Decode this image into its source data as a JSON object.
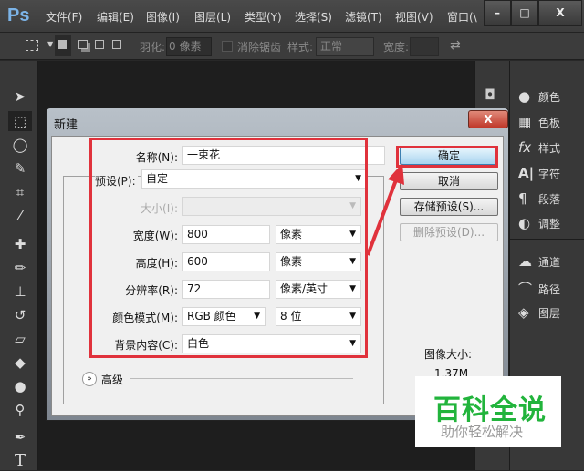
{
  "app": {
    "logo": "Ps",
    "menus": [
      "文件(F)",
      "编辑(E)",
      "图像(I)",
      "图层(L)",
      "类型(Y)",
      "选择(S)",
      "滤镜(T)",
      "视图(V)",
      "窗口(\\"
    ],
    "window_buttons": [
      "–",
      "□",
      "X"
    ]
  },
  "options": {
    "feather_label": "羽化:",
    "feather_value": "0 像素",
    "antialias_label": "消除锯齿",
    "style_label": "样式:",
    "style_value": "正常",
    "width_label": "宽度:"
  },
  "panels": [
    {
      "icon": "palette",
      "label": "颜色"
    },
    {
      "icon": "swatches",
      "label": "色板"
    },
    {
      "icon": "fx",
      "label": "样式"
    },
    {
      "icon": "character",
      "label": "字符"
    },
    {
      "icon": "paragraph",
      "label": "段落"
    },
    {
      "icon": "adjust",
      "label": "调整"
    },
    {
      "icon": "channels",
      "label": "通道"
    },
    {
      "icon": "paths",
      "label": "路径"
    },
    {
      "icon": "layers",
      "label": "图层"
    }
  ],
  "dialog": {
    "title": "新建",
    "close": "X",
    "name_label": "名称(N):",
    "name_value": "一束花",
    "preset_label": "预设(P):",
    "preset_value": "自定",
    "size_label": "大小(I):",
    "width_label": "宽度(W):",
    "width_value": "800",
    "width_unit": "像素",
    "height_label": "高度(H):",
    "height_value": "600",
    "height_unit": "像素",
    "res_label": "分辨率(R):",
    "res_value": "72",
    "res_unit": "像素/英寸",
    "mode_label": "颜色模式(M):",
    "mode_value": "RGB 颜色",
    "bits_value": "8 位",
    "bg_label": "背景内容(C):",
    "bg_value": "白色",
    "advanced_label": "高级",
    "ok": "确定",
    "cancel": "取消",
    "save_preset": "存储预设(S)...",
    "delete_preset": "删除预设(D)...",
    "image_size_label": "图像大小:",
    "image_size_value": "1.37M"
  },
  "watermark": {
    "title": "百科全说",
    "subtitle": "助你轻松解决"
  },
  "colors": {
    "highlight": "#e0323c",
    "watermark": "#22b43c"
  }
}
